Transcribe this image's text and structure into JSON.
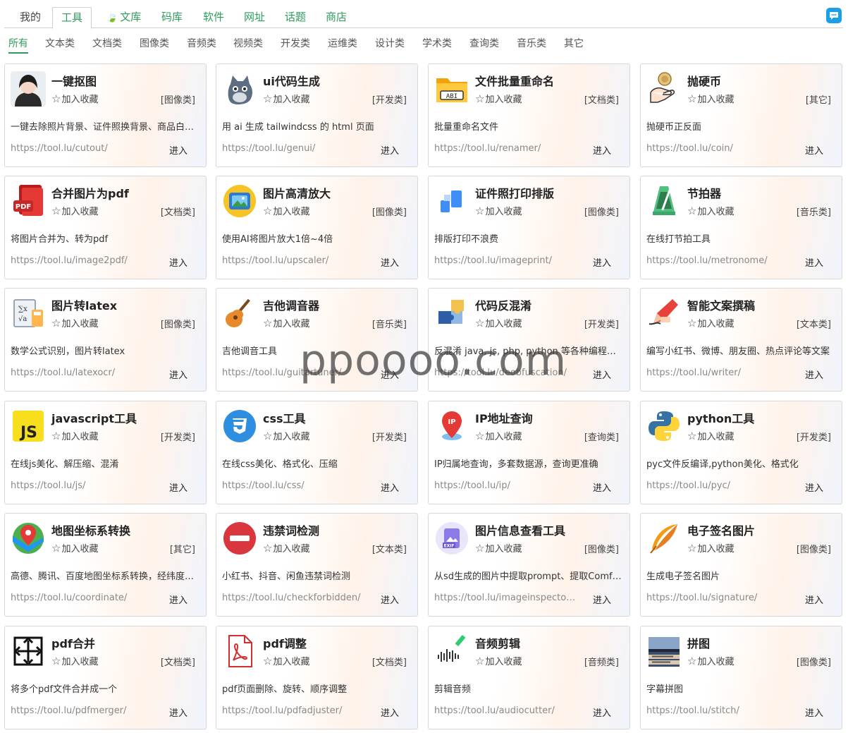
{
  "topnav": {
    "tabs": [
      "我的",
      "工具",
      "文库",
      "码库",
      "软件",
      "网址",
      "话题",
      "商店"
    ],
    "active": "工具"
  },
  "subnav": {
    "items": [
      "所有",
      "文本类",
      "文档类",
      "图像类",
      "音频类",
      "视频类",
      "开发类",
      "运维类",
      "设计类",
      "学术类",
      "查询类",
      "音乐类",
      "其它"
    ],
    "active": "所有"
  },
  "fav_label": "加入收藏",
  "enter_label": "进入",
  "tools": [
    {
      "name": "一键抠图",
      "category": "[图像类]",
      "desc": "一键去除照片背景、证件照换背景、商品白…",
      "url": "https://tool.lu/cutout/",
      "icon": "portrait-icon"
    },
    {
      "name": "ui代码生成",
      "category": "[开发类]",
      "desc": "用 ai 生成 tailwindcss 的 html 页面",
      "url": "https://tool.lu/genui/",
      "icon": "cat-icon"
    },
    {
      "name": "文件批量重命名",
      "category": "[文档类]",
      "desc": "批量重命名文件",
      "url": "https://tool.lu/renamer/",
      "icon": "folder-abi-icon"
    },
    {
      "name": "抛硬币",
      "category": "[其它]",
      "desc": "抛硬币正反面",
      "url": "https://tool.lu/coin/",
      "icon": "coin-flip-icon"
    },
    {
      "name": "合并图片为pdf",
      "category": "[文档类]",
      "desc": "将图片合并为、转为pdf",
      "url": "https://tool.lu/image2pdf/",
      "icon": "pdf-icon"
    },
    {
      "name": "图片高清放大",
      "category": "[图像类]",
      "desc": "使用AI将图片放大1倍~4倍",
      "url": "https://tool.lu/upscaler/",
      "icon": "image-upscale-icon"
    },
    {
      "name": "证件照打印排版",
      "category": "[图像类]",
      "desc": "排版打印不浪费",
      "url": "https://tool.lu/imageprint/",
      "icon": "print-layout-icon"
    },
    {
      "name": "节拍器",
      "category": "[音乐类]",
      "desc": "在线打节拍工具",
      "url": "https://tool.lu/metronome/",
      "icon": "metronome-icon"
    },
    {
      "name": "图片转latex",
      "category": "[图像类]",
      "desc": "数学公式识别，图片转latex",
      "url": "https://tool.lu/latexocr/",
      "icon": "formula-icon"
    },
    {
      "name": "吉他调音器",
      "category": "[音乐类]",
      "desc": "吉他调音工具",
      "url": "https://tool.lu/guitartuner/",
      "icon": "guitar-icon"
    },
    {
      "name": "代码反混淆",
      "category": "[开发类]",
      "desc": "反混淆 java, js, php, python 等各种编程…",
      "url": "https://tool.lu/deobfuscation/",
      "icon": "puzzle-icon"
    },
    {
      "name": "智能文案撰稿",
      "category": "[文本类]",
      "desc": "编写小红书、微博、朋友圈、热点评论等文案",
      "url": "https://tool.lu/writer/",
      "icon": "pen-writing-icon"
    },
    {
      "name": "javascript工具",
      "category": "[开发类]",
      "desc": "在线js美化、解压缩、混淆",
      "url": "https://tool.lu/js/",
      "icon": "js-icon"
    },
    {
      "name": "css工具",
      "category": "[开发类]",
      "desc": "在线css美化、格式化、压缩",
      "url": "https://tool.lu/css/",
      "icon": "css-icon"
    },
    {
      "name": "IP地址查询",
      "category": "[查询类]",
      "desc": "IP归属地查询，多套数据源，查询更准确",
      "url": "https://tool.lu/ip/",
      "icon": "ip-location-icon"
    },
    {
      "name": "python工具",
      "category": "[开发类]",
      "desc": "pyc文件反编译,python美化、格式化",
      "url": "https://tool.lu/pyc/",
      "icon": "python-icon"
    },
    {
      "name": "地图坐标系转换",
      "category": "[其它]",
      "desc": "高德、腾讯、百度地图坐标系转换，经纬度…",
      "url": "https://tool.lu/coordinate/",
      "icon": "map-pin-icon"
    },
    {
      "name": "违禁词检测",
      "category": "[文本类]",
      "desc": "小红书、抖音、闲鱼违禁词检测",
      "url": "https://tool.lu/checkforbidden/",
      "icon": "forbidden-icon"
    },
    {
      "name": "图片信息查看工具",
      "category": "[图像类]",
      "desc": "从sd生成的图片中提取prompt、提取Comf…",
      "url": "https://tool.lu/imageinspecto…",
      "icon": "exif-icon"
    },
    {
      "name": "电子签名图片",
      "category": "[图像类]",
      "desc": "生成电子签名图片",
      "url": "https://tool.lu/signature/",
      "icon": "feather-icon"
    },
    {
      "name": "pdf合并",
      "category": "[文档类]",
      "desc": "将多个pdf文件合并成一个",
      "url": "https://tool.lu/pdfmerger/",
      "icon": "merge-arrows-icon"
    },
    {
      "name": "pdf调整",
      "category": "[文档类]",
      "desc": "pdf页面删除、旋转、顺序调整",
      "url": "https://tool.lu/pdfadjuster/",
      "icon": "acrobat-icon"
    },
    {
      "name": "音频剪辑",
      "category": "[音频类]",
      "desc": "剪辑音频",
      "url": "https://tool.lu/audiocutter/",
      "icon": "audio-wave-icon"
    },
    {
      "name": "拼图",
      "category": "[图像类]",
      "desc": "字幕拼图",
      "url": "https://tool.lu/stitch/",
      "icon": "stitch-photo-icon"
    }
  ],
  "watermark": "ppoooo.com"
}
